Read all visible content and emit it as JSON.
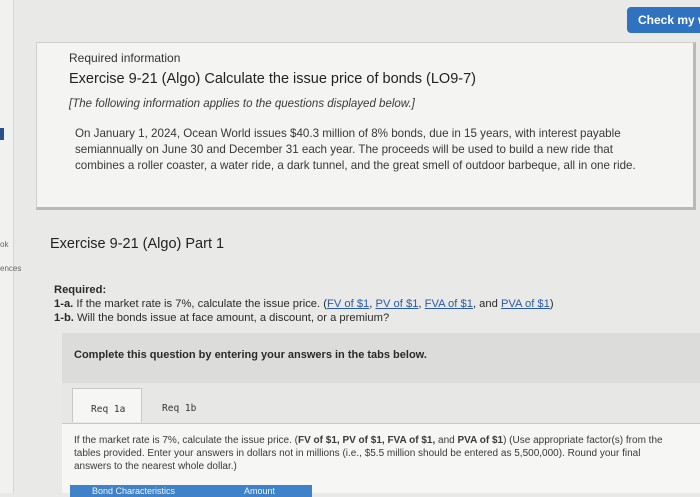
{
  "sidebar": {
    "labels": [
      "ok",
      "ences"
    ]
  },
  "header": {
    "check_button": "Check my w"
  },
  "info": {
    "heading": "Required information",
    "title": "Exercise 9-21 (Algo) Calculate the issue price of bonds (LO9-7)",
    "note": "[The following information applies to the questions displayed below.]",
    "paragraph": "On January 1, 2024, Ocean World issues $40.3 million of 8% bonds, due in 15 years, with interest payable semiannually on June 30 and December 31 each year. The proceeds will be used to build a new ride that combines a roller coaster, a water ride, a dark tunnel, and the great smell of outdoor barbeque, all in one ride."
  },
  "part": {
    "title": "Exercise 9-21 (Algo) Part 1"
  },
  "required": {
    "label": "Required:",
    "item_1a_num": "1-a.",
    "item_1a_text": "If the market rate is 7%, calculate the issue price. (",
    "links": [
      "FV of $1",
      "PV of $1",
      "FVA of $1",
      "PVA of $1"
    ],
    "item_1b_num": "1-b.",
    "item_1b_text": "Will the bonds issue at face amount, a discount, or a premium?"
  },
  "instructions": {
    "text": "Complete this question by entering your answers in the tabs below."
  },
  "tabs": [
    {
      "label": "Req 1a",
      "active": true
    },
    {
      "label": "Req 1b",
      "active": false
    }
  ],
  "question": {
    "text_1": "If the market rate is 7%, calculate the issue price. (",
    "bold_1": "FV of $1, PV of $1, FVA of $1,",
    "text_2": " and ",
    "bold_2": "PVA of $1",
    "text_3": ") (Use appropriate factor(s) from the tables provided. Enter your answers in dollars not in millions (i.e., $5.5 million should be entered as 5,500,000). Round your final answers to the nearest whole dollar.)"
  },
  "table": {
    "col_1": "Bond Characteristics",
    "col_2": "Amount"
  }
}
